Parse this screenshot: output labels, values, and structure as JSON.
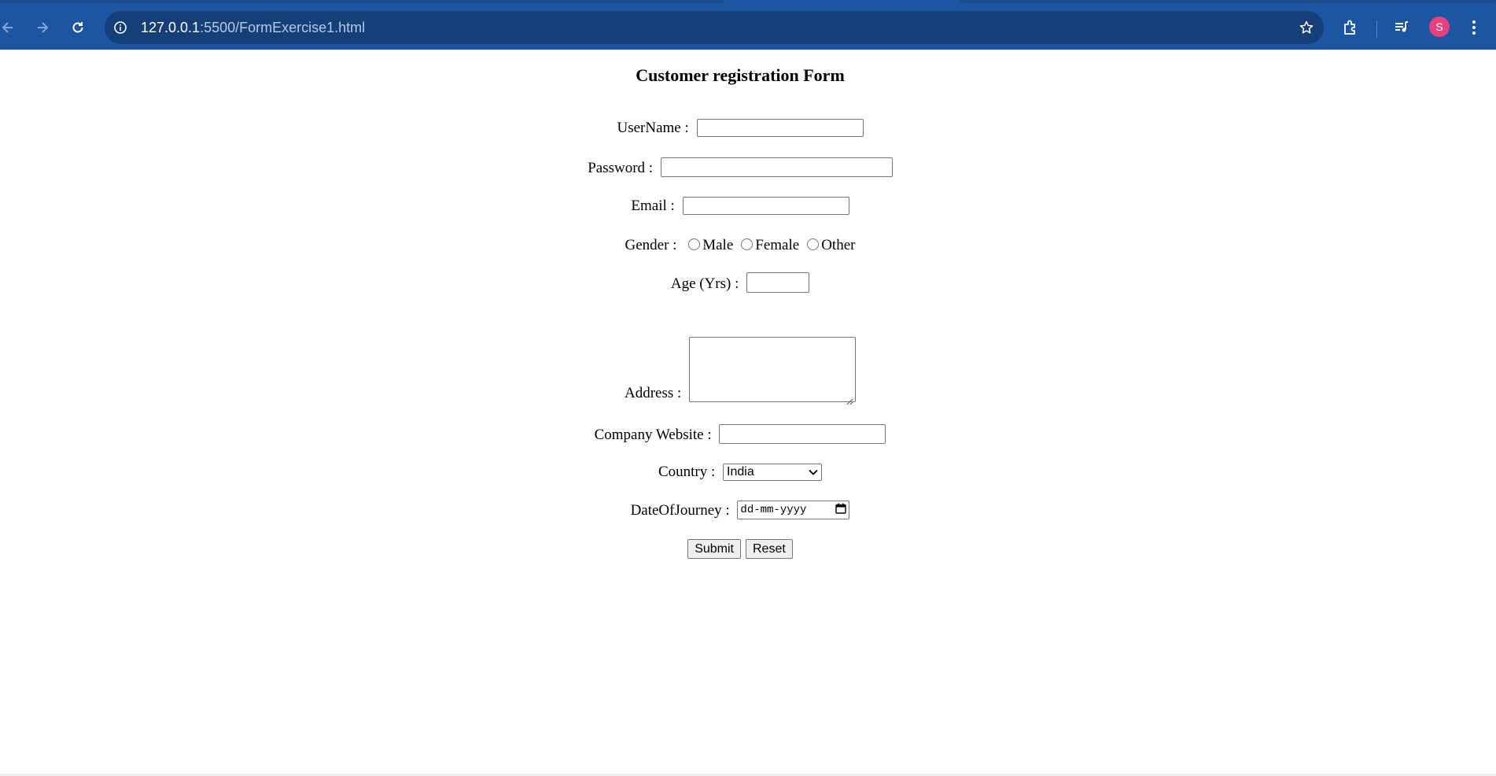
{
  "browser": {
    "url_host": "127.0.0.1",
    "url_path": ":5500/FormExercise1.html",
    "profile_initial": "S",
    "accent_color": "#1c56a3",
    "icons": [
      "back-arrow-icon",
      "forward-arrow-icon",
      "reload-icon",
      "info-icon",
      "star-icon",
      "extensions-icon",
      "media-control-icon",
      "more-menu-icon"
    ]
  },
  "form": {
    "title": "Customer registration Form",
    "username_label": "UserName : ",
    "username_value": "",
    "password_label": "Password : ",
    "password_value": "",
    "email_label": "Email : ",
    "email_value": "",
    "gender_label": "Gender : ",
    "gender_options": [
      "Male",
      "Female",
      "Other"
    ],
    "age_label": "Age (Yrs) : ",
    "age_value": "",
    "address_label": "Address : ",
    "address_value": "",
    "website_label": "Company Website : ",
    "website_value": "",
    "country_label": "Country : ",
    "country_selected": "India",
    "date_label": "DateOfJourney : ",
    "date_placeholder": "dd-mm-yyyy",
    "submit_label": "Submit",
    "reset_label": "Reset"
  }
}
